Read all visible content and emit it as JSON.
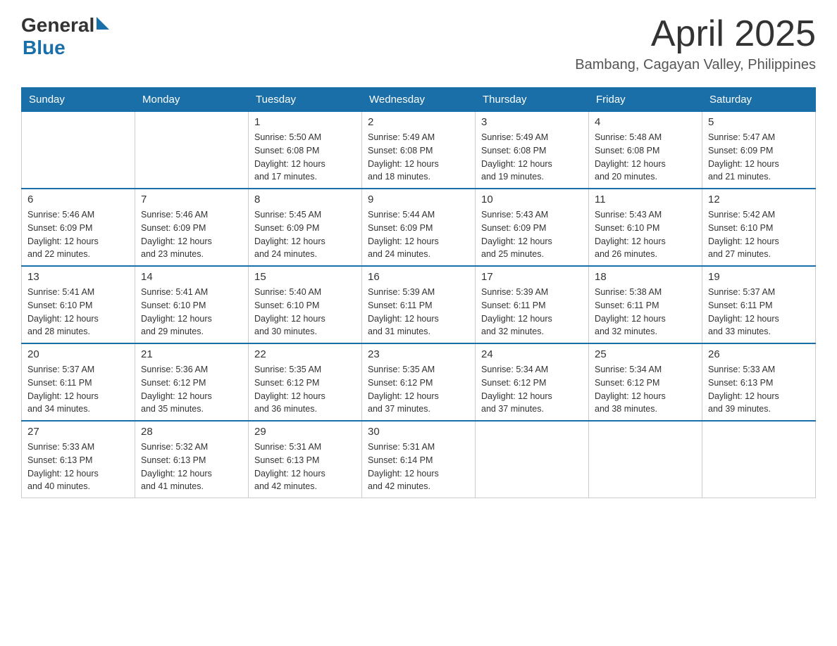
{
  "header": {
    "logo_general": "General",
    "logo_blue": "Blue",
    "month_title": "April 2025",
    "location": "Bambang, Cagayan Valley, Philippines"
  },
  "calendar": {
    "days_of_week": [
      "Sunday",
      "Monday",
      "Tuesday",
      "Wednesday",
      "Thursday",
      "Friday",
      "Saturday"
    ],
    "weeks": [
      [
        {
          "day": "",
          "info": ""
        },
        {
          "day": "",
          "info": ""
        },
        {
          "day": "1",
          "info": "Sunrise: 5:50 AM\nSunset: 6:08 PM\nDaylight: 12 hours\nand 17 minutes."
        },
        {
          "day": "2",
          "info": "Sunrise: 5:49 AM\nSunset: 6:08 PM\nDaylight: 12 hours\nand 18 minutes."
        },
        {
          "day": "3",
          "info": "Sunrise: 5:49 AM\nSunset: 6:08 PM\nDaylight: 12 hours\nand 19 minutes."
        },
        {
          "day": "4",
          "info": "Sunrise: 5:48 AM\nSunset: 6:08 PM\nDaylight: 12 hours\nand 20 minutes."
        },
        {
          "day": "5",
          "info": "Sunrise: 5:47 AM\nSunset: 6:09 PM\nDaylight: 12 hours\nand 21 minutes."
        }
      ],
      [
        {
          "day": "6",
          "info": "Sunrise: 5:46 AM\nSunset: 6:09 PM\nDaylight: 12 hours\nand 22 minutes."
        },
        {
          "day": "7",
          "info": "Sunrise: 5:46 AM\nSunset: 6:09 PM\nDaylight: 12 hours\nand 23 minutes."
        },
        {
          "day": "8",
          "info": "Sunrise: 5:45 AM\nSunset: 6:09 PM\nDaylight: 12 hours\nand 24 minutes."
        },
        {
          "day": "9",
          "info": "Sunrise: 5:44 AM\nSunset: 6:09 PM\nDaylight: 12 hours\nand 24 minutes."
        },
        {
          "day": "10",
          "info": "Sunrise: 5:43 AM\nSunset: 6:09 PM\nDaylight: 12 hours\nand 25 minutes."
        },
        {
          "day": "11",
          "info": "Sunrise: 5:43 AM\nSunset: 6:10 PM\nDaylight: 12 hours\nand 26 minutes."
        },
        {
          "day": "12",
          "info": "Sunrise: 5:42 AM\nSunset: 6:10 PM\nDaylight: 12 hours\nand 27 minutes."
        }
      ],
      [
        {
          "day": "13",
          "info": "Sunrise: 5:41 AM\nSunset: 6:10 PM\nDaylight: 12 hours\nand 28 minutes."
        },
        {
          "day": "14",
          "info": "Sunrise: 5:41 AM\nSunset: 6:10 PM\nDaylight: 12 hours\nand 29 minutes."
        },
        {
          "day": "15",
          "info": "Sunrise: 5:40 AM\nSunset: 6:10 PM\nDaylight: 12 hours\nand 30 minutes."
        },
        {
          "day": "16",
          "info": "Sunrise: 5:39 AM\nSunset: 6:11 PM\nDaylight: 12 hours\nand 31 minutes."
        },
        {
          "day": "17",
          "info": "Sunrise: 5:39 AM\nSunset: 6:11 PM\nDaylight: 12 hours\nand 32 minutes."
        },
        {
          "day": "18",
          "info": "Sunrise: 5:38 AM\nSunset: 6:11 PM\nDaylight: 12 hours\nand 32 minutes."
        },
        {
          "day": "19",
          "info": "Sunrise: 5:37 AM\nSunset: 6:11 PM\nDaylight: 12 hours\nand 33 minutes."
        }
      ],
      [
        {
          "day": "20",
          "info": "Sunrise: 5:37 AM\nSunset: 6:11 PM\nDaylight: 12 hours\nand 34 minutes."
        },
        {
          "day": "21",
          "info": "Sunrise: 5:36 AM\nSunset: 6:12 PM\nDaylight: 12 hours\nand 35 minutes."
        },
        {
          "day": "22",
          "info": "Sunrise: 5:35 AM\nSunset: 6:12 PM\nDaylight: 12 hours\nand 36 minutes."
        },
        {
          "day": "23",
          "info": "Sunrise: 5:35 AM\nSunset: 6:12 PM\nDaylight: 12 hours\nand 37 minutes."
        },
        {
          "day": "24",
          "info": "Sunrise: 5:34 AM\nSunset: 6:12 PM\nDaylight: 12 hours\nand 37 minutes."
        },
        {
          "day": "25",
          "info": "Sunrise: 5:34 AM\nSunset: 6:12 PM\nDaylight: 12 hours\nand 38 minutes."
        },
        {
          "day": "26",
          "info": "Sunrise: 5:33 AM\nSunset: 6:13 PM\nDaylight: 12 hours\nand 39 minutes."
        }
      ],
      [
        {
          "day": "27",
          "info": "Sunrise: 5:33 AM\nSunset: 6:13 PM\nDaylight: 12 hours\nand 40 minutes."
        },
        {
          "day": "28",
          "info": "Sunrise: 5:32 AM\nSunset: 6:13 PM\nDaylight: 12 hours\nand 41 minutes."
        },
        {
          "day": "29",
          "info": "Sunrise: 5:31 AM\nSunset: 6:13 PM\nDaylight: 12 hours\nand 42 minutes."
        },
        {
          "day": "30",
          "info": "Sunrise: 5:31 AM\nSunset: 6:14 PM\nDaylight: 12 hours\nand 42 minutes."
        },
        {
          "day": "",
          "info": ""
        },
        {
          "day": "",
          "info": ""
        },
        {
          "day": "",
          "info": ""
        }
      ]
    ]
  }
}
